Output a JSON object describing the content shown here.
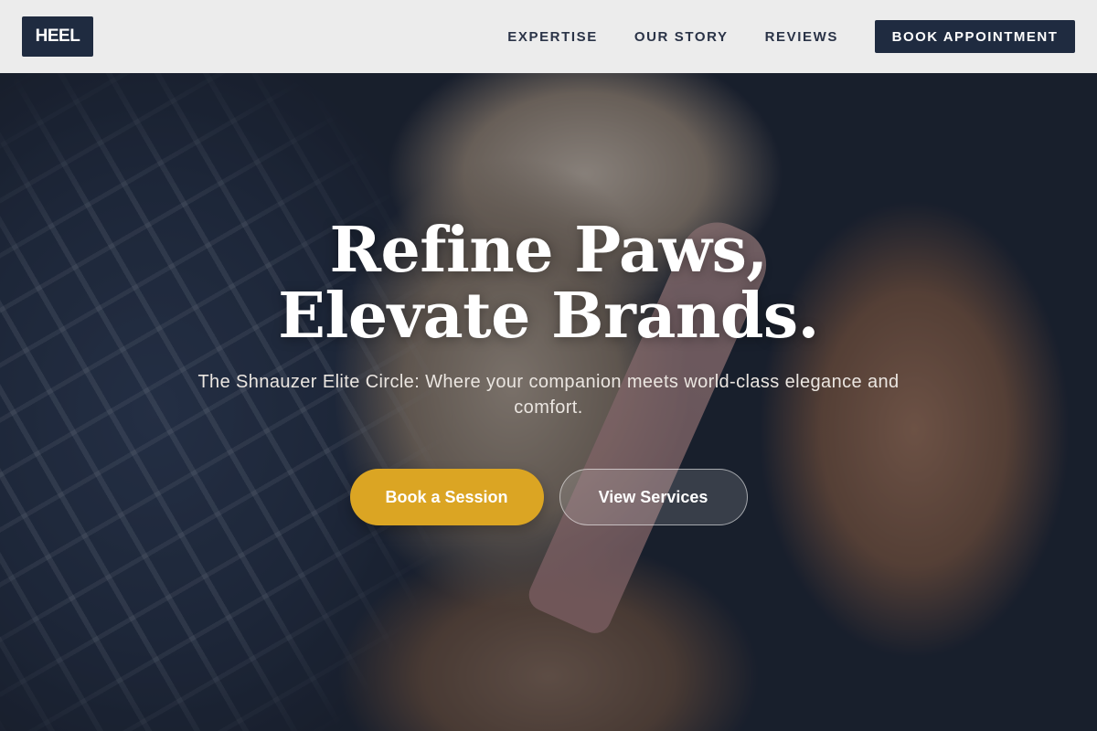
{
  "header": {
    "logo_text": "HEEL",
    "nav": [
      {
        "label": "EXPERTISE"
      },
      {
        "label": "OUR STORY"
      },
      {
        "label": "REVIEWS"
      }
    ],
    "cta_label": "BOOK APPOINTMENT"
  },
  "hero": {
    "title": "Refine Paws, Elevate Brands.",
    "subtitle": "The Shnauzer Elite Circle: Where your companion meets world-class elegance and comfort.",
    "primary_button": "Book a Session",
    "secondary_button": "View Services"
  },
  "colors": {
    "navy": "#1f2b40",
    "gold": "#dba523",
    "header_bg": "#ececec"
  }
}
